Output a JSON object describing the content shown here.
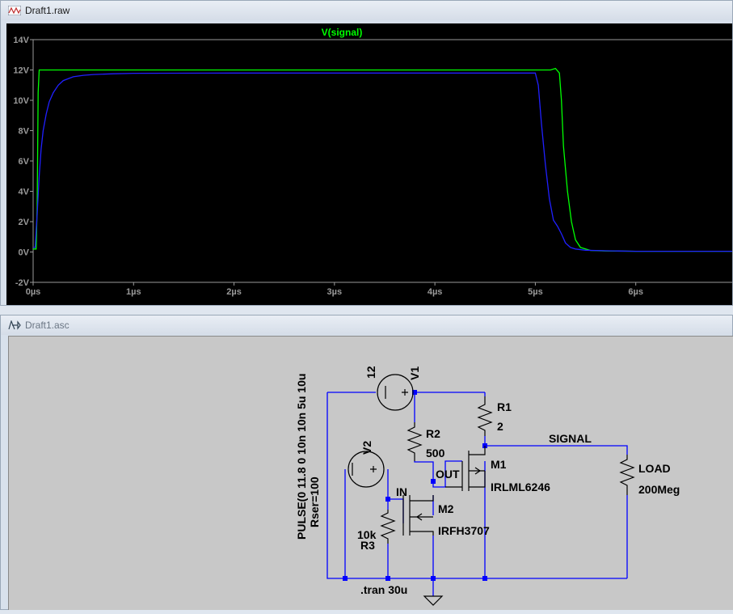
{
  "plot_window": {
    "title": "Draft1.raw",
    "icon": "waveform-icon"
  },
  "schematic_window": {
    "title": "Draft1.asc",
    "icon": "schematic-icon"
  },
  "chart_data": {
    "type": "line",
    "title": "V(signal)",
    "title_color": "#00ff00",
    "background": "#000000",
    "xlim": [
      0,
      6.96
    ],
    "ylim": [
      -2,
      14
    ],
    "yticks": [
      14,
      12,
      10,
      8,
      6,
      4,
      2,
      0,
      -2
    ],
    "ytick_labels": [
      "14V",
      "12V",
      "10V",
      "8V",
      "6V",
      "4V",
      "2V",
      "0V",
      "-2V"
    ],
    "xticks": [
      0,
      1,
      2,
      3,
      4,
      5,
      6
    ],
    "xtick_labels": [
      "0µs",
      "1µs",
      "2µs",
      "3µs",
      "4µs",
      "5µs",
      "6µs"
    ],
    "grid": false,
    "series": [
      {
        "name": "V(signal)",
        "color": "#00ff00",
        "x": [
          0,
          0.03,
          0.04,
          0.05,
          0.06,
          0.07,
          5.15,
          5.2,
          5.24,
          5.26,
          5.28,
          5.32,
          5.36,
          5.4,
          5.45,
          5.55,
          5.7,
          6,
          6.96
        ],
        "y": [
          0.2,
          0.2,
          3,
          10.5,
          12,
          12,
          12,
          12.1,
          11.8,
          10,
          7,
          4,
          2,
          0.8,
          0.3,
          0.1,
          0.07,
          0.05,
          0.05
        ]
      },
      {
        "name": "",
        "color": "#2020ff",
        "x": [
          0,
          0.02,
          0.04,
          0.06,
          0.08,
          0.1,
          0.13,
          0.16,
          0.2,
          0.25,
          0.3,
          0.4,
          0.5,
          0.6,
          0.8,
          1,
          2,
          3,
          4,
          4.9,
          5.0,
          5.03,
          5.06,
          5.1,
          5.14,
          5.18,
          5.22,
          5.26,
          5.3,
          5.35,
          5.4,
          5.5,
          5.7,
          6,
          6.96
        ],
        "y": [
          0.3,
          0.3,
          2.5,
          5,
          6.8,
          8,
          9.1,
          9.9,
          10.5,
          11,
          11.3,
          11.55,
          11.65,
          11.7,
          11.75,
          11.78,
          11.8,
          11.8,
          11.8,
          11.8,
          11.8,
          11,
          8.5,
          5.8,
          3.5,
          2.1,
          1.7,
          1.2,
          0.6,
          0.3,
          0.2,
          0.12,
          0.08,
          0.05,
          0.05
        ]
      }
    ]
  },
  "schematic": {
    "v1": {
      "name": "V1",
      "value": "12"
    },
    "v2": {
      "name": "V2",
      "value": "PULSE(0 11.8 0 10n 10n 5u 10u",
      "value2": "Rser=100"
    },
    "r1": {
      "name": "R1",
      "value": "2"
    },
    "r2": {
      "name": "R2",
      "value": "500"
    },
    "r3": {
      "name": "R3",
      "value": "10k"
    },
    "m1": {
      "name": "M1",
      "value": "IRLML6246"
    },
    "m2": {
      "name": "M2",
      "value": "IRFH3707"
    },
    "load": {
      "name": "LOAD",
      "value": "200Meg"
    },
    "nets": {
      "signal": "SIGNAL",
      "out": "OUT",
      "in": "IN"
    },
    "directive": ".tran 30u",
    "wire_color": "#0000ff",
    "part_color": "#000000"
  }
}
